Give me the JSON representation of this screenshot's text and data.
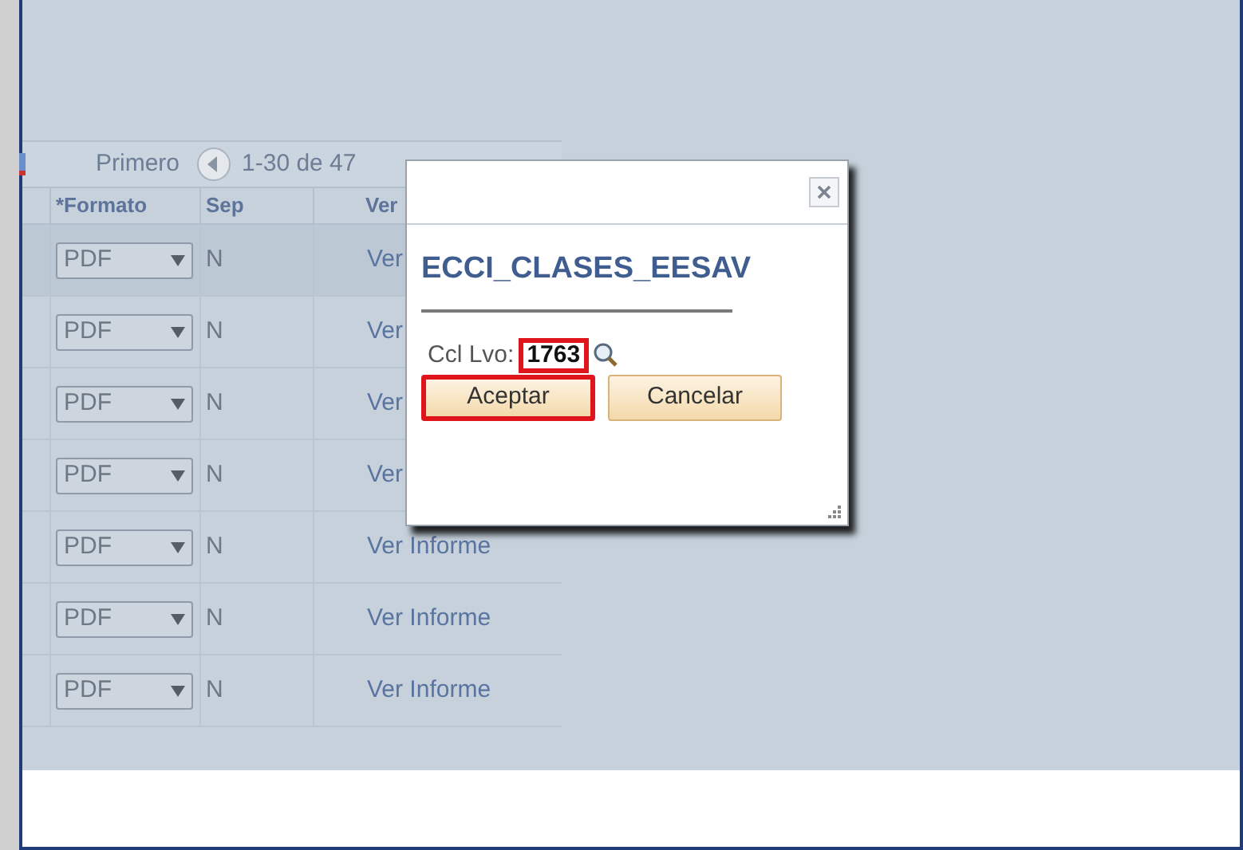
{
  "pager": {
    "first": "Primero",
    "range": "1-30 de 47"
  },
  "table": {
    "columns": [
      "*Formato",
      "Sep",
      "Ver"
    ],
    "rows": [
      {
        "format": "PDF",
        "sep": "N",
        "link": "Ver"
      },
      {
        "format": "PDF",
        "sep": "N",
        "link": "Ver"
      },
      {
        "format": "PDF",
        "sep": "N",
        "link": "Ver"
      },
      {
        "format": "PDF",
        "sep": "N",
        "link": "Ver"
      },
      {
        "format": "PDF",
        "sep": "N",
        "link": "Ver Informe"
      },
      {
        "format": "PDF",
        "sep": "N",
        "link": "Ver Informe"
      },
      {
        "format": "PDF",
        "sep": "N",
        "link": "Ver Informe"
      }
    ]
  },
  "dialog": {
    "title": "ECCI_CLASES_EESAV",
    "field": {
      "label": "Ccl Lvo:",
      "value": "1763",
      "highlighted": true
    },
    "buttons": [
      {
        "label": "Aceptar",
        "highlighted": true
      },
      {
        "label": "Cancelar",
        "highlighted": false
      }
    ]
  }
}
